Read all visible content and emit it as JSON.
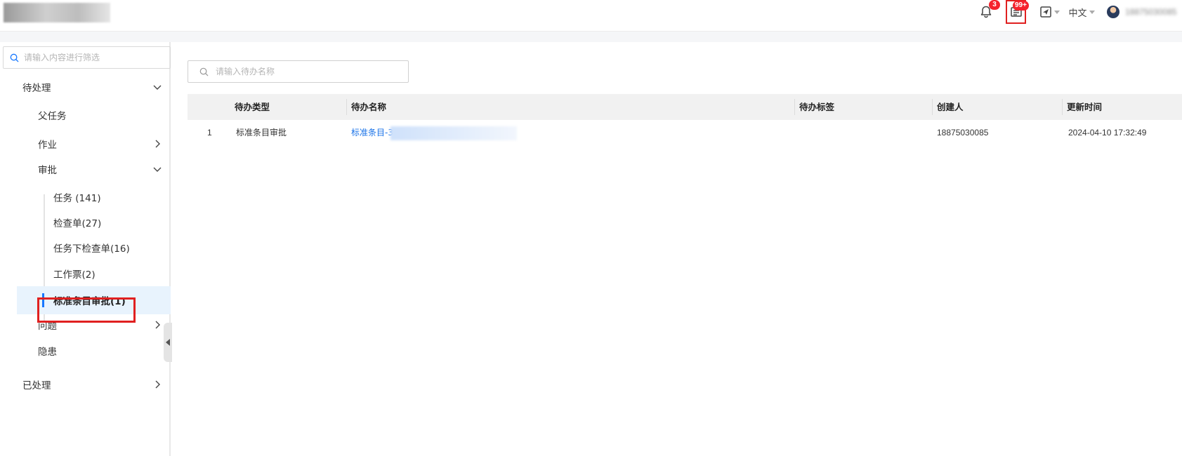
{
  "header": {
    "bell_badge": "3",
    "todo_badge": "99+",
    "language": "中文",
    "user_name": "18875030085"
  },
  "sidebar": {
    "search_placeholder": "请输入内容进行筛选",
    "pending_label": "待处理",
    "parent_task": "父任务",
    "job": "作业",
    "approval": "审批",
    "approval_items": [
      {
        "label": "任务 (141)"
      },
      {
        "label": "检查单(27)"
      },
      {
        "label": "任务下检查单(16)"
      },
      {
        "label": "工作票(2)"
      },
      {
        "label": "标准条目审批(1)"
      }
    ],
    "issue": "问题",
    "hazard": "隐患",
    "processed_label": "已处理"
  },
  "main": {
    "search_placeholder": "请输入待办名称",
    "columns": [
      "待办类型",
      "待办名称",
      "待办标签",
      "创建人",
      "更新时间"
    ],
    "rows": [
      {
        "index": "1",
        "type": "标准条目审批",
        "name": "标准条目-3",
        "tag": "",
        "creator": "18875030085",
        "updated": "2024-04-10 17:32:49"
      }
    ]
  },
  "colors": {
    "accent": "#1677ff",
    "link": "#1a73e8",
    "highlight_box": "#e02020",
    "active_row_bg": "#e8f3fd",
    "badge": "#f5222d"
  },
  "icons": [
    "search-icon",
    "bell-icon",
    "todo-list-icon",
    "send-icon",
    "chevron-down-icon",
    "chevron-right-icon",
    "collapse-left-icon"
  ]
}
